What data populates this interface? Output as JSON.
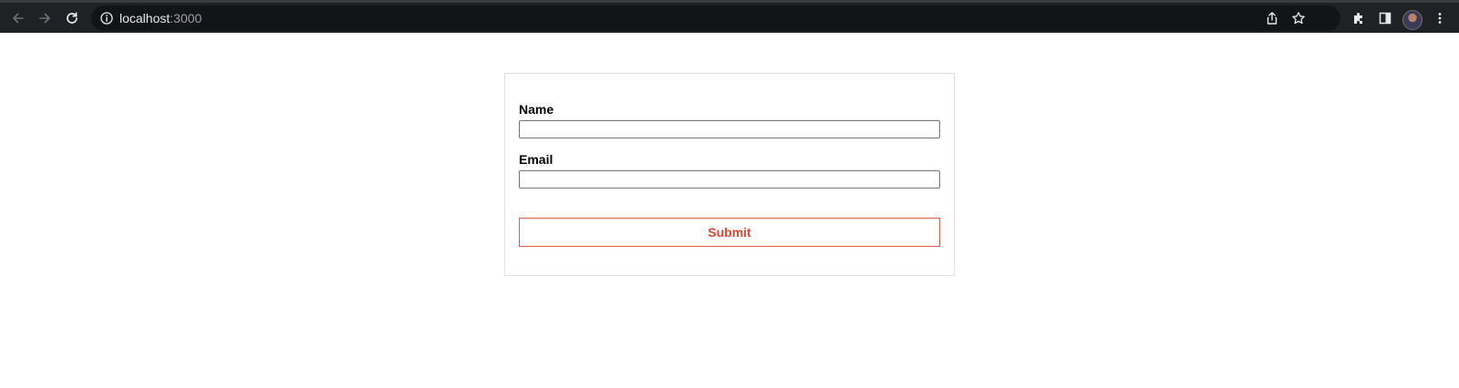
{
  "browser": {
    "url_host": "localhost",
    "url_port": ":3000",
    "icons": [
      "back-arrow-icon",
      "forward-arrow-icon",
      "reload-icon",
      "info-icon",
      "share-icon",
      "star-icon",
      "extensions-icon",
      "side-panel-icon",
      "profile-avatar",
      "more-menu-icon"
    ],
    "colors": {
      "toolbar": "#202124",
      "omnibox": "#131417",
      "icon": "#e8eaed",
      "icon_disabled": "#6b6f76"
    }
  },
  "form": {
    "name_label": "Name",
    "name_value": "",
    "email_label": "Email",
    "email_value": "",
    "submit_label": "Submit",
    "colors": {
      "accent": "#e0442d",
      "card_border": "#e0e0e0"
    }
  }
}
